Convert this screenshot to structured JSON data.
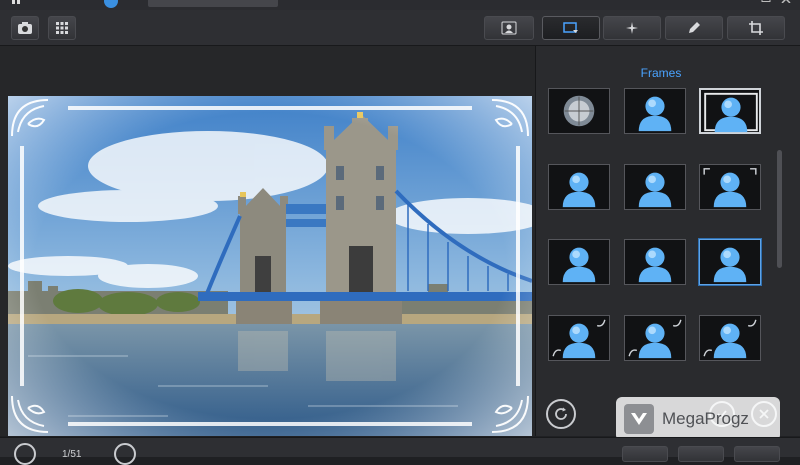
{
  "panel": {
    "title": "Frames"
  },
  "bottom": {
    "counter": "1/51"
  },
  "watermark": {
    "text": "MegaProgz"
  },
  "toolbar": {
    "buttons": [
      {
        "icon": "camera-icon"
      },
      {
        "icon": "grid-icon"
      },
      {
        "icon": "user-switch-icon"
      },
      {
        "icon": "frame-icon"
      },
      {
        "icon": "sparkle-icon"
      },
      {
        "icon": "pen-icon"
      },
      {
        "icon": "crop-icon"
      }
    ]
  },
  "frames": [
    {
      "style": "lens",
      "state": "normal"
    },
    {
      "style": "plain",
      "state": "normal"
    },
    {
      "style": "white-border",
      "state": "selected"
    },
    {
      "style": "plain",
      "state": "normal"
    },
    {
      "style": "plain",
      "state": "normal"
    },
    {
      "style": "corners",
      "state": "normal"
    },
    {
      "style": "plain",
      "state": "normal"
    },
    {
      "style": "plain",
      "state": "normal"
    },
    {
      "style": "plain",
      "state": "hover"
    },
    {
      "style": "ornate",
      "state": "normal"
    },
    {
      "style": "ornate",
      "state": "normal"
    },
    {
      "style": "ornate",
      "state": "normal"
    }
  ],
  "colors": {
    "accent": "#4aa3ff",
    "background": "#1f2023",
    "panel": "#2a2b2e"
  }
}
